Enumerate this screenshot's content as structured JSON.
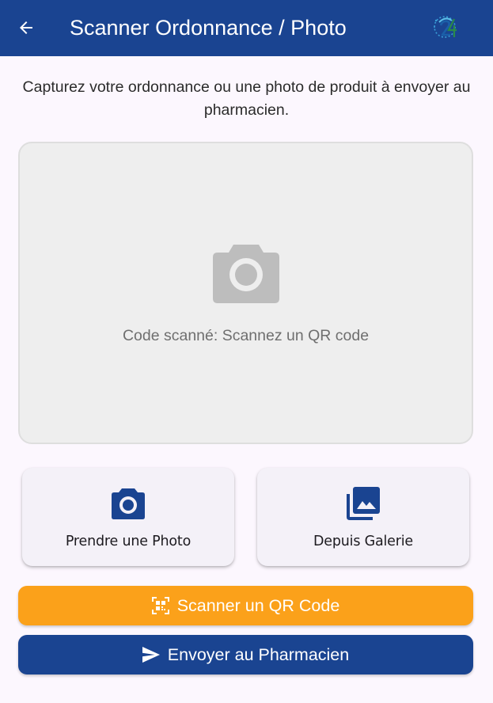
{
  "appbar": {
    "title": "Scanner Ordonnance / Photo",
    "back_icon": "arrow-left-icon",
    "logo": "app-logo-24",
    "background_color": "#1a4491"
  },
  "intro": {
    "text": "Capturez votre ordonnance ou une photo de produit à envoyer au pharmacien."
  },
  "preview": {
    "icon": "camera-icon",
    "status_text": "Code scanné: Scannez un QR code"
  },
  "actions": {
    "take_photo": {
      "label": "Prendre une Photo",
      "icon": "camera-icon"
    },
    "gallery": {
      "label": "Depuis Galerie",
      "icon": "photo-library-icon"
    }
  },
  "buttons": {
    "scan_qr": {
      "label": "Scanner un QR Code",
      "icon": "qr-scan-icon",
      "color": "#fba11a"
    },
    "send": {
      "label": "Envoyer au Pharmacien",
      "icon": "send-icon",
      "color": "#1a4491"
    }
  }
}
